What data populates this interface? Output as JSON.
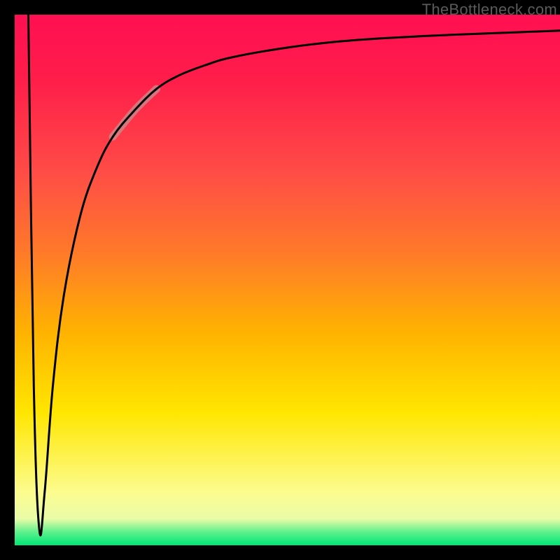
{
  "attribution": "TheBottleneck.com",
  "colors": {
    "background": "#000000",
    "gradient_top": "#ff0f52",
    "gradient_mid_high": "#ff7a29",
    "gradient_mid": "#ffe600",
    "gradient_low": "#eafca8",
    "gradient_bottom": "#00e676",
    "curve": "#000000",
    "highlight_segment": "#c98c8c"
  },
  "plot_frame": {
    "outer_w": 800,
    "outer_h": 800,
    "inner_left": 21,
    "inner_top": 21,
    "inner_w": 779,
    "inner_h": 758
  },
  "chart_data": {
    "type": "line",
    "title": "",
    "xlabel": "",
    "ylabel": "",
    "xlim": [
      0,
      100
    ],
    "ylim": [
      0,
      100
    ],
    "series": [
      {
        "name": "bottleneck-curve",
        "x": [
          2.5,
          3.5,
          4.5,
          5.5,
          7,
          9,
          12,
          15,
          18,
          22,
          26,
          30,
          35,
          40,
          50,
          60,
          70,
          80,
          90,
          100
        ],
        "y": [
          100,
          30,
          3,
          10,
          30,
          47,
          62,
          71,
          77,
          82,
          86,
          88.5,
          90.5,
          92,
          93.8,
          95,
          95.7,
          96.2,
          96.6,
          97
        ]
      }
    ],
    "annotations": [
      {
        "name": "highlighted-segment",
        "x_start": 18,
        "x_end": 28,
        "description": "soft light-red thick overlay on ascending part of curve"
      }
    ]
  }
}
